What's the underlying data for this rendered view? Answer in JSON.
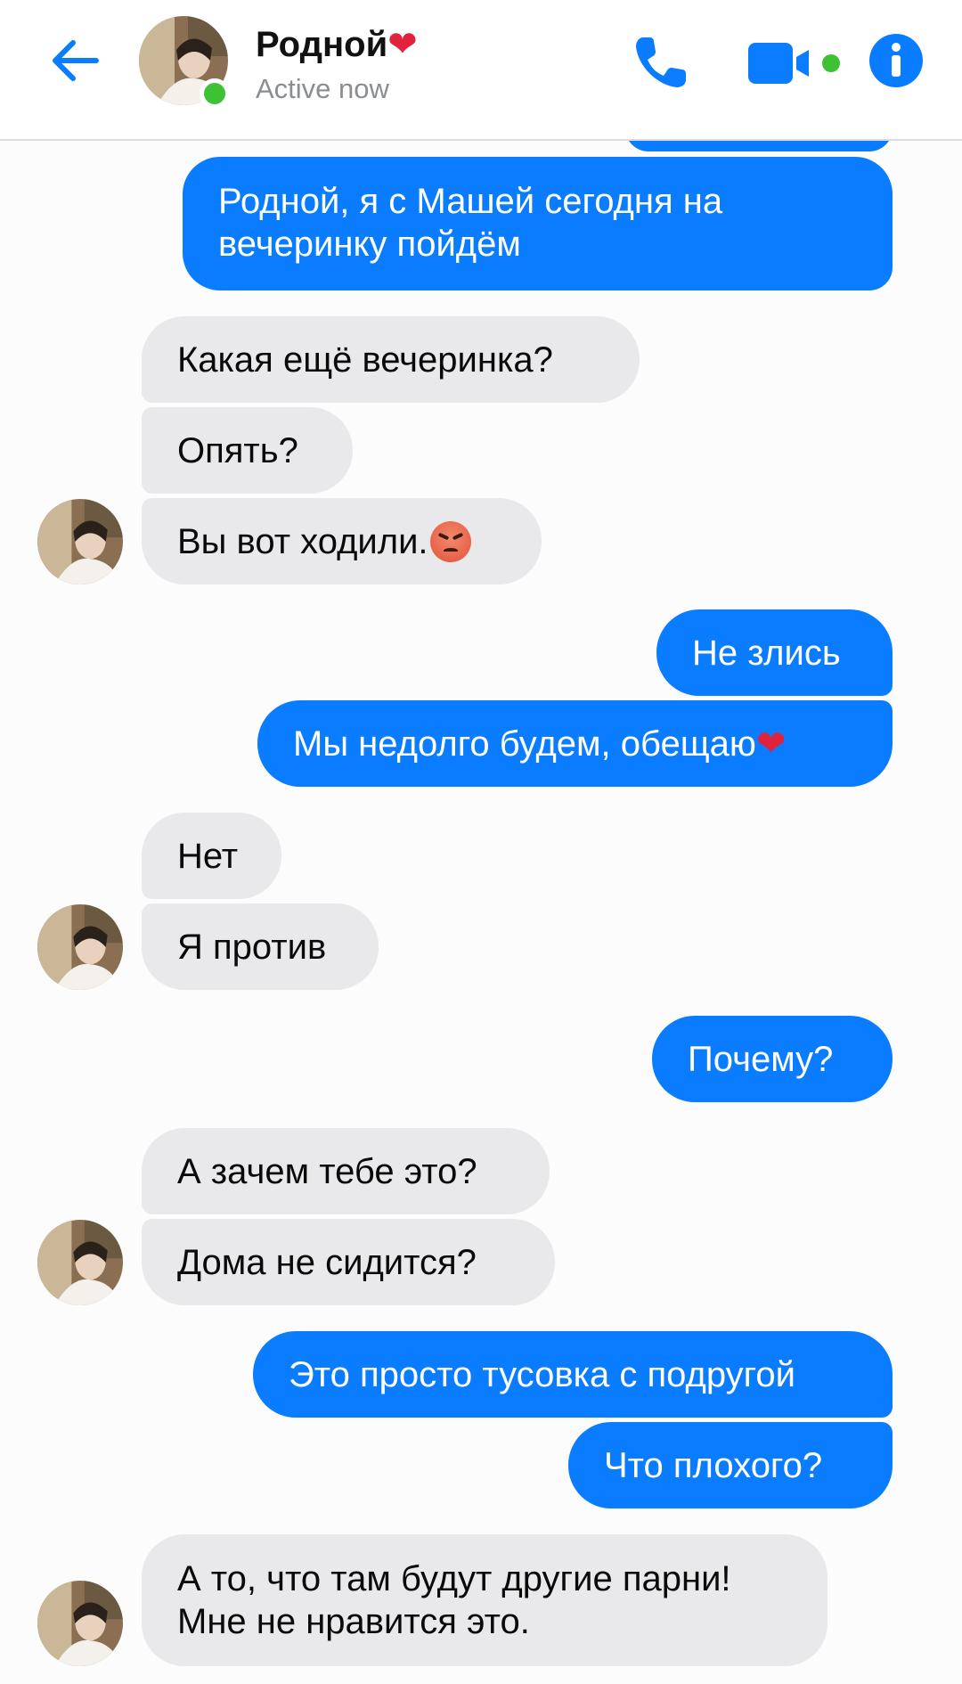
{
  "header": {
    "contact_name": "Родной",
    "name_emoji": "❤",
    "status": "Active now"
  },
  "colors": {
    "accent": "#0a7cff",
    "incoming_bubble": "#e9e9eb",
    "online": "#3ec233"
  },
  "icons": [
    "back-arrow-icon",
    "phone-icon",
    "video-camera-icon",
    "info-icon"
  ],
  "messages": [
    {
      "dir": "out",
      "text_line1": "Родной, я с Машей сегодня на",
      "text_line2": "вечеринку пойдём"
    },
    {
      "dir": "in",
      "text": "Какая ещё вечеринка?"
    },
    {
      "dir": "in",
      "text": "Опять?"
    },
    {
      "dir": "in",
      "text": "Вы вот ходили.",
      "emoji": "angry-face"
    },
    {
      "dir": "out",
      "text": "Не злись"
    },
    {
      "dir": "out",
      "text": "Мы недолго будем, обещаю",
      "emoji": "❤"
    },
    {
      "dir": "in",
      "text": "Нет"
    },
    {
      "dir": "in",
      "text": "Я против"
    },
    {
      "dir": "out",
      "text": "Почему?"
    },
    {
      "dir": "in",
      "text": "А зачем тебе это?"
    },
    {
      "dir": "in",
      "text": "Дома не сидится?"
    },
    {
      "dir": "out",
      "text": "Это просто тусовка с подругой"
    },
    {
      "dir": "out",
      "text": "Что плохого?"
    },
    {
      "dir": "in",
      "text_line1": "А то, что там будут другие парни!",
      "text_line2": "Мне не нравится это."
    }
  ]
}
